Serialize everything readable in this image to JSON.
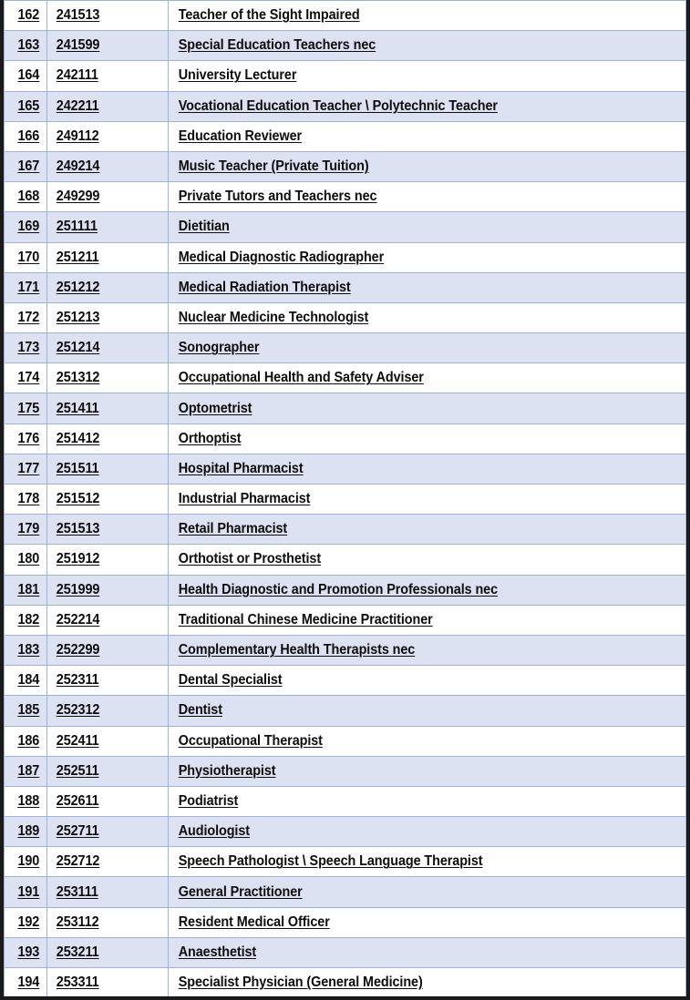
{
  "document": {
    "type": "occupation-list-table",
    "columns": [
      "index",
      "occupation_code",
      "occupation_title"
    ],
    "colors": {
      "shaded_row": "#DCE2F1",
      "plain_row": "#FFFFFF",
      "cell_border": "#9DB3DA",
      "page_border": "#1A1A1A",
      "text": "#0D0D0D"
    },
    "row_count": 33,
    "first_index": "162",
    "last_index": "194"
  },
  "rows": [
    {
      "index": "162",
      "code": "241513",
      "title": "Teacher of the Sight Impaired",
      "shaded": false
    },
    {
      "index": "163",
      "code": "241599",
      "title": "Special Education Teachers nec",
      "shaded": true
    },
    {
      "index": "164",
      "code": "242111",
      "title": "University Lecturer",
      "shaded": false
    },
    {
      "index": "165",
      "code": "242211",
      "title": "Vocational Education Teacher \\ Polytechnic Teacher",
      "shaded": true
    },
    {
      "index": "166",
      "code": "249112",
      "title": "Education Reviewer",
      "shaded": false
    },
    {
      "index": "167",
      "code": "249214",
      "title": "Music Teacher (Private Tuition)",
      "shaded": true
    },
    {
      "index": "168",
      "code": "249299",
      "title": "Private Tutors and Teachers nec",
      "shaded": false
    },
    {
      "index": "169",
      "code": "251111",
      "title": "Dietitian",
      "shaded": true
    },
    {
      "index": "170",
      "code": "251211",
      "title": "Medical Diagnostic Radiographer",
      "shaded": false
    },
    {
      "index": "171",
      "code": "251212",
      "title": "Medical Radiation Therapist",
      "shaded": true
    },
    {
      "index": "172",
      "code": "251213",
      "title": "Nuclear Medicine Technologist",
      "shaded": false
    },
    {
      "index": "173",
      "code": "251214",
      "title": "Sonographer",
      "shaded": true
    },
    {
      "index": "174",
      "code": "251312",
      "title": "Occupational Health and Safety Adviser",
      "shaded": false
    },
    {
      "index": "175",
      "code": "251411",
      "title": "Optometrist",
      "shaded": true
    },
    {
      "index": "176",
      "code": "251412",
      "title": "Orthoptist",
      "shaded": false
    },
    {
      "index": "177",
      "code": "251511",
      "title": "Hospital Pharmacist",
      "shaded": true
    },
    {
      "index": "178",
      "code": "251512",
      "title": "Industrial Pharmacist",
      "shaded": false
    },
    {
      "index": "179",
      "code": "251513",
      "title": "Retail Pharmacist",
      "shaded": true
    },
    {
      "index": "180",
      "code": "251912",
      "title": "Orthotist or Prosthetist",
      "shaded": false
    },
    {
      "index": "181",
      "code": "251999",
      "title": "Health Diagnostic and Promotion Professionals nec",
      "shaded": true
    },
    {
      "index": "182",
      "code": "252214",
      "title": "Traditional Chinese Medicine Practitioner",
      "shaded": false
    },
    {
      "index": "183",
      "code": "252299",
      "title": "Complementary Health Therapists nec",
      "shaded": true
    },
    {
      "index": "184",
      "code": "252311",
      "title": "Dental Specialist",
      "shaded": false
    },
    {
      "index": "185",
      "code": "252312",
      "title": "Dentist",
      "shaded": true
    },
    {
      "index": "186",
      "code": "252411",
      "title": "Occupational Therapist",
      "shaded": false
    },
    {
      "index": "187",
      "code": "252511",
      "title": "Physiotherapist",
      "shaded": true
    },
    {
      "index": "188",
      "code": "252611",
      "title": "Podiatrist",
      "shaded": false
    },
    {
      "index": "189",
      "code": "252711",
      "title": "Audiologist",
      "shaded": true
    },
    {
      "index": "190",
      "code": "252712",
      "title": "Speech Pathologist \\ Speech Language Therapist",
      "shaded": false
    },
    {
      "index": "191",
      "code": "253111",
      "title": "General Practitioner",
      "shaded": true
    },
    {
      "index": "192",
      "code": "253112",
      "title": "Resident Medical Officer",
      "shaded": false
    },
    {
      "index": "193",
      "code": "253211",
      "title": "Anaesthetist",
      "shaded": true
    },
    {
      "index": "194",
      "code": "253311",
      "title": "Specialist Physician (General Medicine)",
      "shaded": false
    }
  ]
}
